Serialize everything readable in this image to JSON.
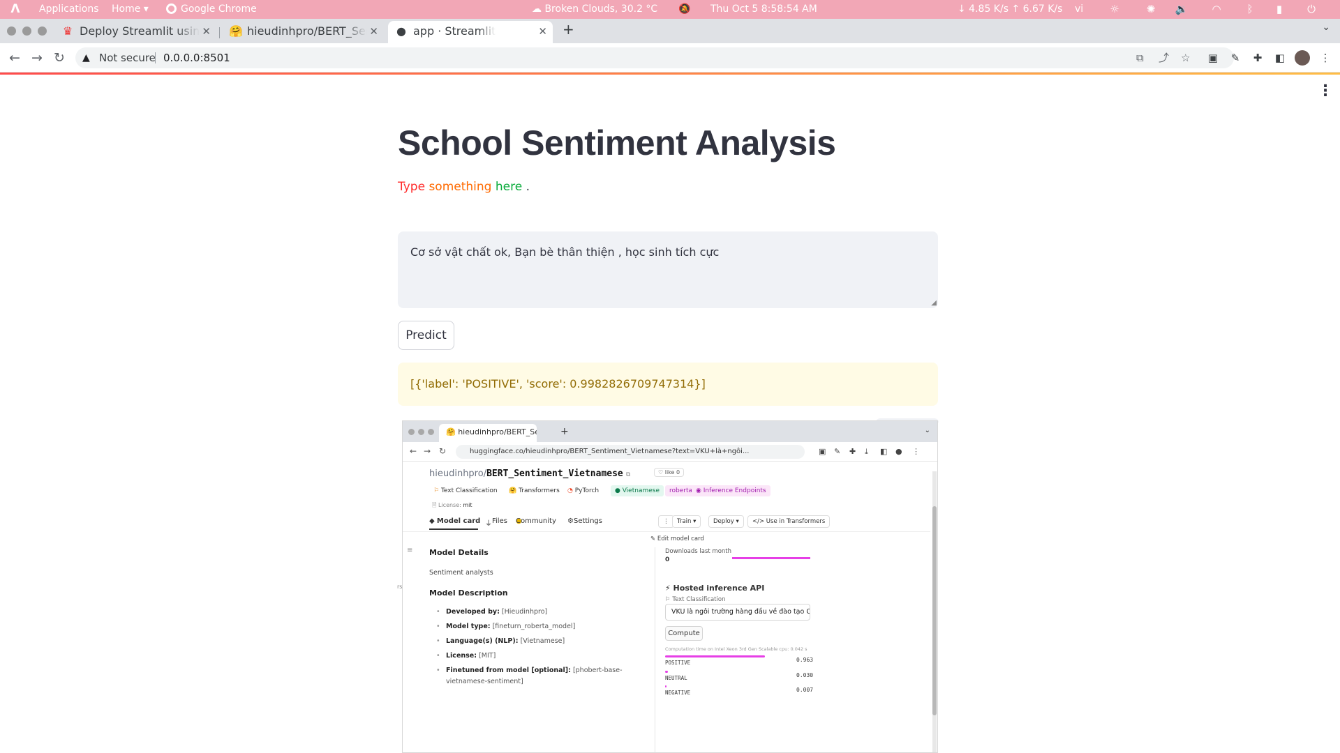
{
  "system_bar": {
    "apps": "Applications",
    "home": "Home ▾",
    "chrome": "Google Chrome",
    "weather": "Broken Clouds, 30.2 °C",
    "clock": "Thu Oct 5   8:58:54 AM",
    "net": "↓ 4.85 K/s  ↑ 6.67 K/s",
    "lang": "vi"
  },
  "browser": {
    "tabs": [
      {
        "label": "Deploy Streamlit using",
        "icon": "streamlit-crown-icon"
      },
      {
        "label": "hieudinhpro/BERT_Sen",
        "icon": "huggingface-icon"
      },
      {
        "label": "app · Streamlit",
        "icon": "github-icon"
      }
    ],
    "not_secure": "Not secure",
    "url": "0.0.0.0:8501"
  },
  "app": {
    "title": "School Sentiment Analysis",
    "subtitle": {
      "w1": "Type",
      "w2": "something",
      "w3": "here",
      "w4": "."
    },
    "input_value": "Cơ sở vật chất ok, Bạn bè thân thiện , học sinh tích cực",
    "predict_label": "Predict",
    "result": "[{'label': 'POSITIVE', 'score': 0.9982826709747314}]",
    "colors": {
      "accent": "#ff4b4b",
      "result_bg": "#fffbe5",
      "result_text": "#926c05"
    }
  },
  "embedded": {
    "tab_label": "hieudinhpro/BERT_Sen",
    "url": "huggingface.co/hieudinhpro/BERT_Sentiment_Vietnamese?text=VKU+là+ngôi...",
    "user": "hieudinhpro",
    "slash": "/",
    "model": "BERT_Sentiment_Vietnamese",
    "like": "♡ like  0",
    "tags": [
      "Text Classification",
      "Transformers",
      "PyTorch",
      "Vietnamese",
      "roberta",
      "Inference Endpoints"
    ],
    "license_label": "License:",
    "license_value": "mit",
    "nav_tabs": [
      "Model card",
      "Files",
      "Community",
      "Settings"
    ],
    "buttons": [
      "⋮",
      "Train ▾",
      "Deploy ▾",
      "</> Use in Transformers"
    ],
    "edit_card": "✎ Edit model card",
    "model_details": "Model Details",
    "sentiment_analysts": "Sentiment analysts",
    "model_description": "Model Description",
    "details": [
      {
        "k": "Developed by:",
        "v": " [Hieudinhpro]"
      },
      {
        "k": "Model type:",
        "v": " [fineturn_roberta_model]"
      },
      {
        "k": "Language(s) (NLP):",
        "v": " [Vietnamese]"
      },
      {
        "k": "License:",
        "v": " [MIT]"
      },
      {
        "k": "Finetuned from model [optional]:",
        "v": " [phobert-base-"
      }
    ],
    "details_cont": "vietnamese-sentiment]",
    "downloads_label": "Downloads last month",
    "downloads_value": "0",
    "api_title": "⚡ Hosted inference API",
    "api_task": "Text Classification",
    "api_input": "VKU là ngôi trường hàng đầu về đào tạo CNTT",
    "compute": "Compute",
    "compute_time": "Computation time on Intel Xeon 3rd Gen Scalable cpu: 0.042 s",
    "scores": [
      {
        "label": "POSITIVE",
        "score": "0.963",
        "frac": 0.963
      },
      {
        "label": "NEUTRAL",
        "score": "0.030",
        "frac": 0.03
      },
      {
        "label": "NEGATIVE",
        "score": "0.007",
        "frac": 0.007
      }
    ]
  }
}
